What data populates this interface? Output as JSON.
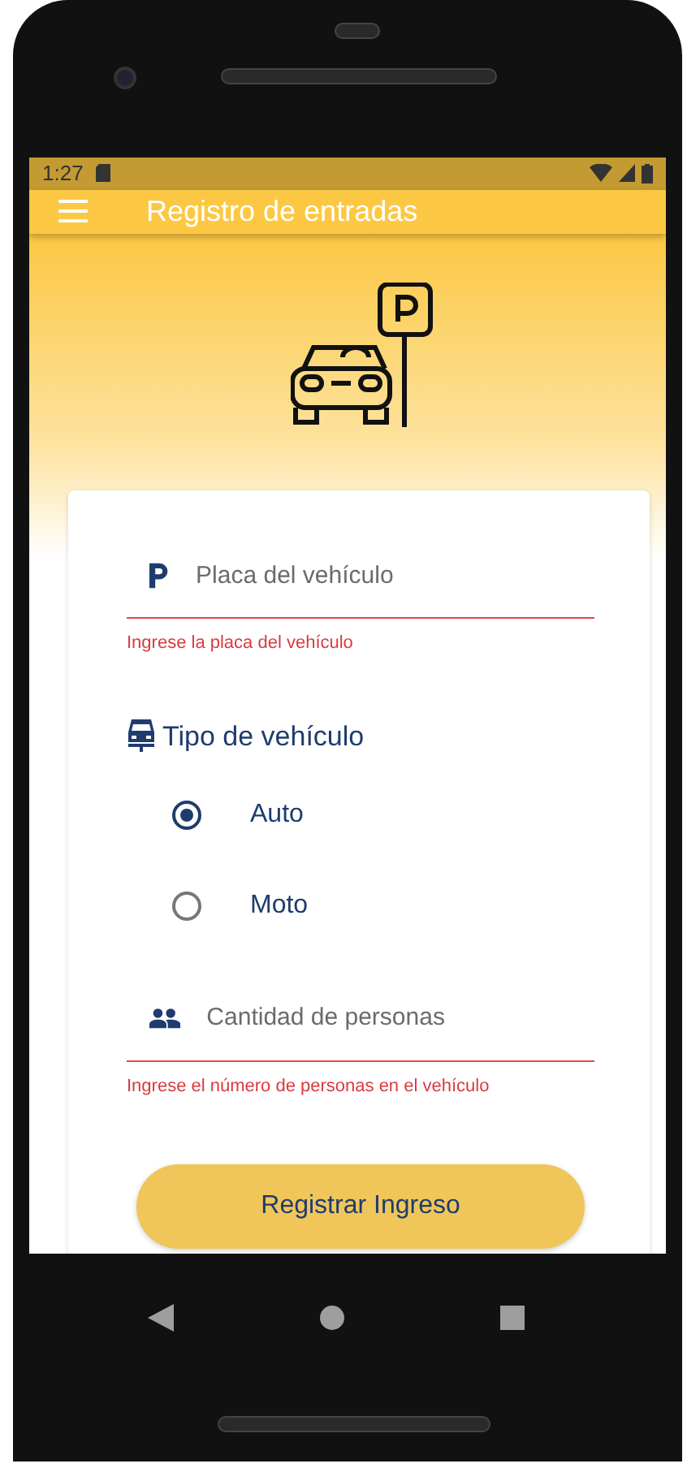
{
  "status_bar": {
    "time": "1:27"
  },
  "app_bar": {
    "title": "Registro de entradas"
  },
  "form": {
    "plate_field": {
      "placeholder": "Placa del vehículo",
      "error": "Ingrese la placa del vehículo"
    },
    "vehicle_type": {
      "label": "Tipo de vehículo",
      "options": [
        {
          "label": "Auto",
          "selected": true
        },
        {
          "label": "Moto",
          "selected": false
        }
      ]
    },
    "people_field": {
      "placeholder": "Cantidad de personas",
      "error": "Ingrese el número de personas en el vehículo"
    },
    "submit_button": {
      "label": "Registrar Ingreso"
    }
  }
}
